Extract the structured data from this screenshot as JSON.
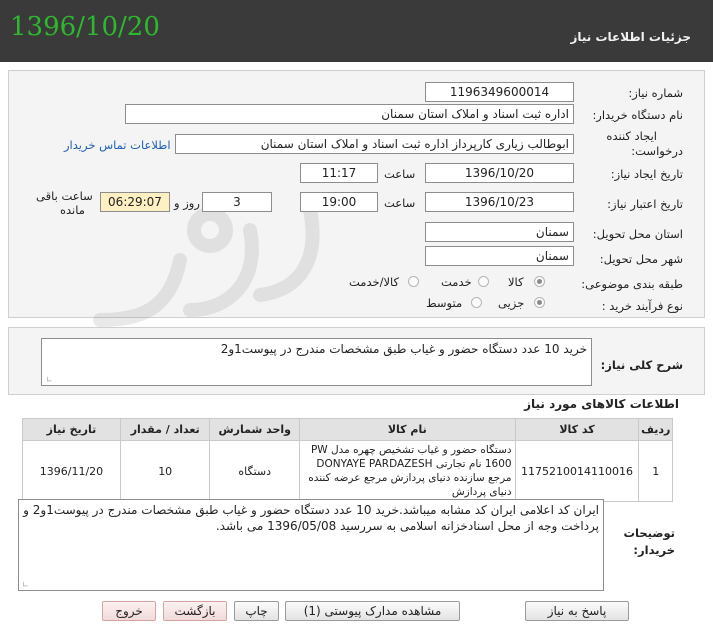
{
  "header": {
    "date": "1396/10/20",
    "title": "جزئیات اطلاعات نیاز"
  },
  "form": {
    "need_number_label": "شماره نیاز:",
    "need_number": "1196349600014",
    "buyer_org_label": "نام دستگاه خریدار:",
    "buyer_org": "اداره ثبت اسناد و املاک استان سمنان",
    "creator_label_1": "ایجاد کننده",
    "creator_label_2": "درخواست:",
    "creator": "ابوطالب زیاری کارپرداز اداره ثبت اسناد و املاک استان سمنان",
    "contact_link": "اطلاعات تماس خریدار",
    "created_date_label": "تاریخ ایجاد نیاز:",
    "created_date": "1396/10/20",
    "time_label": "ساعت",
    "created_time": "11:17",
    "validity_label": "تاریخ اعتبار نیاز:",
    "validity_date": "1396/10/23",
    "validity_time": "19:00",
    "days_label": "روز و",
    "days": "3",
    "remaining_time": "06:29:07",
    "remaining_label_1": "ساعت باقی",
    "remaining_label_2": "مانده",
    "province_label": "استان محل تحویل:",
    "province": "سمنان",
    "city_label": "شهر محل تحویل:",
    "city": "سمنان",
    "category_label": "طبقه بندی موضوعی:",
    "category_options": [
      "کالا",
      "خدمت",
      "کالا/خدمت"
    ],
    "category_selected": "کالا",
    "process_label": "نوع فرآیند خرید :",
    "process_options": [
      "جزیی",
      "متوسط"
    ],
    "process_selected": "جزیی"
  },
  "summary": {
    "label": "شرح کلی نیاز:",
    "text": "خرید 10 عدد دستگاه حضور و غیاب طبق مشخصات مندرج در پیوست1و2"
  },
  "items": {
    "section_title": "اطلاعات کالاهای مورد نیاز",
    "columns": [
      "ردیف",
      "کد کالا",
      "نام کالا",
      "واحد شمارش",
      "تعداد / مقدار",
      "تاریخ نیاز"
    ],
    "rows": [
      {
        "row": "1",
        "code": "1175210014110016",
        "name": "دستگاه حضور و غیاب تشخیص چهره مدل PW 1600 نام تجارتی DONYAYE PARDAZESH مرجع سازنده دنیای پردازش مرجع عرضه کننده دنیای پردازش",
        "unit": "دستگاه",
        "qty": "10",
        "date": "1396/11/20"
      }
    ]
  },
  "buyer_notes": {
    "label_1": "توضیحات",
    "label_2": "خریدار:",
    "text": "ایران کد اعلامی ایران کد مشابه میباشد.خرید 10 عدد دستگاه حضور و غیاب طبق مشخصات مندرج در پیوست1و2 و پرداخت وجه از محل اسنادخزانه اسلامی به سررسید 1396/05/08 می باشد."
  },
  "buttons": {
    "reply": "پاسخ به نیاز",
    "attachments": "مشاهده مدارک پیوستی (1)",
    "print": "چاپ",
    "back": "بازگشت",
    "exit": "خروج"
  },
  "colors": {
    "header_bg": "#3a3a3a",
    "date_color": "#2db82d",
    "link_color": "#1f5fb5",
    "remaining_bg": "#fdf0c2"
  }
}
